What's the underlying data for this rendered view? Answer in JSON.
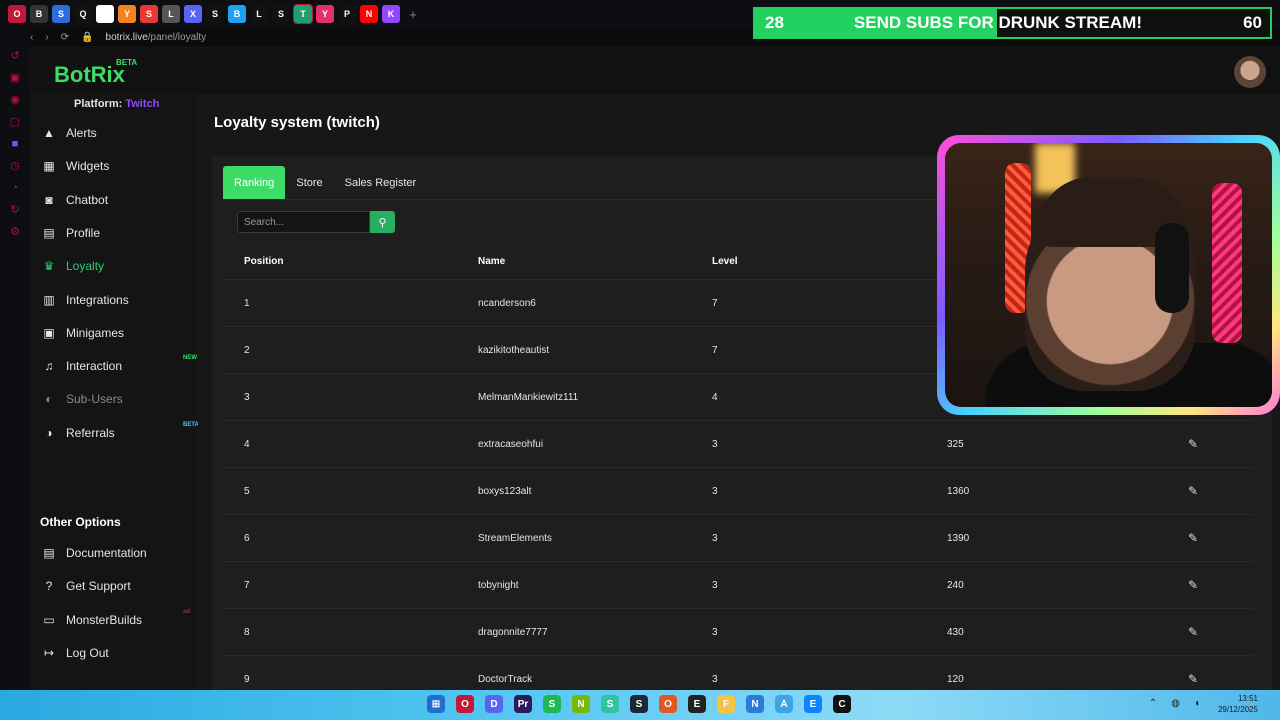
{
  "browser": {
    "url_host": "botrix.live",
    "url_path": "/panel/loyalty",
    "tabs": [
      "O",
      "B",
      "S",
      "Q",
      "T",
      "Y",
      "S",
      "L",
      "X",
      "S",
      "B",
      "L",
      "S",
      "T",
      "Y",
      "P",
      "N",
      "K",
      "+"
    ]
  },
  "overlay": {
    "left_number": "28",
    "message": "SEND SUBS FOR DRUNK STREAM!",
    "right_number": "60",
    "progress": 0.47,
    "color": "#23d160"
  },
  "app": {
    "logo": "BotRix",
    "logo_badge": "BETA",
    "platform_label": "Platform:",
    "platform_value": "Twitch",
    "accent": "#3ddc67"
  },
  "sidebar": {
    "items": [
      {
        "label": "Alerts",
        "icon": "warning-icon"
      },
      {
        "label": "Widgets",
        "icon": "grid-icon"
      },
      {
        "label": "Chatbot",
        "icon": "robot-icon"
      },
      {
        "label": "Profile",
        "icon": "id-card-icon"
      },
      {
        "label": "Loyalty",
        "icon": "trophy-icon"
      },
      {
        "label": "Integrations",
        "icon": "plug-icon"
      },
      {
        "label": "Minigames",
        "icon": "gamepad-icon"
      },
      {
        "label": "Interaction",
        "icon": "music-icon",
        "badge": "NEW"
      },
      {
        "label": "Sub-Users",
        "icon": "users-icon"
      },
      {
        "label": "Referrals",
        "icon": "people-icon",
        "badge": "BETA"
      }
    ],
    "other_title": "Other Options",
    "other_items": [
      {
        "label": "Documentation",
        "icon": "book-icon"
      },
      {
        "label": "Get Support",
        "icon": "question-icon"
      },
      {
        "label": "MonsterBuilds",
        "icon": "laptop-icon",
        "badge": "ad"
      },
      {
        "label": "Log Out",
        "icon": "logout-icon"
      }
    ]
  },
  "page": {
    "title": "Loyalty system (twitch)",
    "tabs": [
      "Ranking",
      "Store",
      "Sales Register"
    ],
    "search_placeholder": "Search..."
  },
  "table": {
    "headers": [
      "Position",
      "Name",
      "Level"
    ],
    "rows": [
      {
        "position": "1",
        "name": "ncanderson6",
        "level": "7",
        "points": ""
      },
      {
        "position": "2",
        "name": "kazikitotheautist",
        "level": "7",
        "points": ""
      },
      {
        "position": "3",
        "name": "MelmanMankiewitz111",
        "level": "4",
        "points": ""
      },
      {
        "position": "4",
        "name": "extracaseohfui",
        "level": "3",
        "points": "325"
      },
      {
        "position": "5",
        "name": "boxys123alt",
        "level": "3",
        "points": "1360"
      },
      {
        "position": "6",
        "name": "StreamElements",
        "level": "3",
        "points": "1390"
      },
      {
        "position": "7",
        "name": "tobynight",
        "level": "3",
        "points": "240"
      },
      {
        "position": "8",
        "name": "dragonnite7777",
        "level": "3",
        "points": "430"
      },
      {
        "position": "9",
        "name": "DoctorTrack",
        "level": "3",
        "points": "120"
      }
    ]
  },
  "taskbar": {
    "time": "13:51",
    "date": "29/12/2025"
  }
}
